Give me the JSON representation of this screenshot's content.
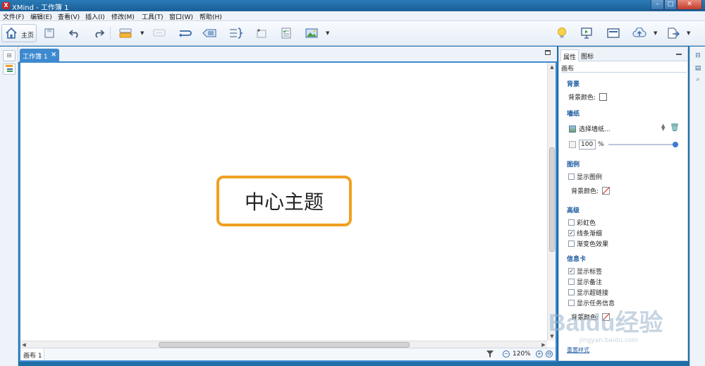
{
  "window": {
    "app_logo": "X",
    "title": "XMind - 工作簿 1",
    "min": "–",
    "max": "□",
    "close": "✕"
  },
  "menu": [
    "文件(F)",
    "编辑(E)",
    "查看(V)",
    "插入(I)",
    "修改(M)",
    "工具(T)",
    "窗口(W)",
    "帮助(H)"
  ],
  "toolbar": {
    "home_label": "主页",
    "icons": [
      "save-icon",
      "undo-icon",
      "redo-icon",
      "topic-icon",
      "callout-icon",
      "relationship-icon",
      "boundary-icon",
      "summary-icon",
      "note-icon",
      "task-icon",
      "image-icon",
      "idea-icon",
      "presentation-icon",
      "layout-icon",
      "share-icon",
      "export-icon"
    ]
  },
  "editor": {
    "tab_label": "工作簿 1",
    "tab_close": "×",
    "central_topic": "中心主题",
    "sheet_tab": "画布 1",
    "zoom": "120%",
    "zoom_minus": "−",
    "zoom_plus": "+",
    "zoom_fit": "⊖"
  },
  "panel": {
    "tabs": [
      "属性",
      "图标"
    ],
    "subtitle": "画布",
    "background": {
      "title": "背景",
      "color_label": "背景颜色:"
    },
    "wallpaper": {
      "title": "墙纸",
      "select_label": "选择墙纸...",
      "opacity_value": "100",
      "opacity_unit": "%",
      "opacity_level": 1.0
    },
    "legend": {
      "title": "图例",
      "show_legend": "显示图例",
      "show_legend_checked": false,
      "color_label": "背景颜色:"
    },
    "advanced": {
      "title": "高级",
      "items": [
        {
          "label": "彩虹色",
          "checked": false
        },
        {
          "label": "线条渐细",
          "checked": true
        },
        {
          "label": "渐变色效果",
          "checked": false
        }
      ]
    },
    "info_card": {
      "title": "信息卡",
      "items": [
        {
          "label": "显示标签",
          "checked": true
        },
        {
          "label": "显示备注",
          "checked": false
        },
        {
          "label": "显示超链接",
          "checked": false
        },
        {
          "label": "显示任务信息",
          "checked": false
        }
      ],
      "color_label": "背景颜色:"
    },
    "link": "重置样式"
  },
  "watermark": {
    "big": "Baidu经验",
    "small": "jingyan.baidu.com"
  },
  "colors": {
    "accent": "#3d8ad0",
    "topic_border": "#f0a020",
    "section_title": "#1d5ba0"
  }
}
